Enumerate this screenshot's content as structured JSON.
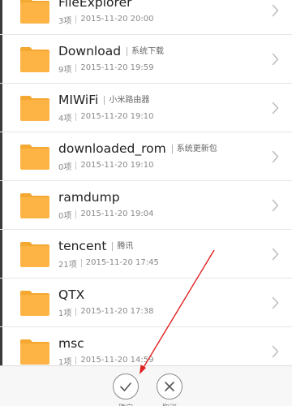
{
  "files": [
    {
      "name": "FileExplorer",
      "tag": "",
      "count": "3项",
      "date": "2015-11-20 20:00"
    },
    {
      "name": "Download",
      "tag": "系统下载",
      "count": "9项",
      "date": "2015-11-20 19:59"
    },
    {
      "name": "MIWiFi",
      "tag": "小米路由器",
      "count": "4项",
      "date": "2015-11-20 19:10"
    },
    {
      "name": "downloaded_rom",
      "tag": "系统更新包",
      "count": "0项",
      "date": "2015-11-20 19:10"
    },
    {
      "name": "ramdump",
      "tag": "",
      "count": "0项",
      "date": "2015-11-20 19:04"
    },
    {
      "name": "tencent",
      "tag": "腾讯",
      "count": "21项",
      "date": "2015-11-20 17:45"
    },
    {
      "name": "QTX",
      "tag": "",
      "count": "1项",
      "date": "2015-11-20 17:38"
    },
    {
      "name": "msc",
      "tag": "",
      "count": "1项",
      "date": "2015-11-20 14:59"
    }
  ],
  "actions": {
    "confirm_label": "确定",
    "cancel_label": "取消"
  },
  "icons": {
    "folder": "folder-icon",
    "chevron": "chevron-right-icon",
    "confirm": "checkmark-icon",
    "cancel": "close-icon"
  },
  "colors": {
    "folder": "#fdb445",
    "folder_tab": "#f4a832",
    "annotation_arrow": "#e02020"
  }
}
